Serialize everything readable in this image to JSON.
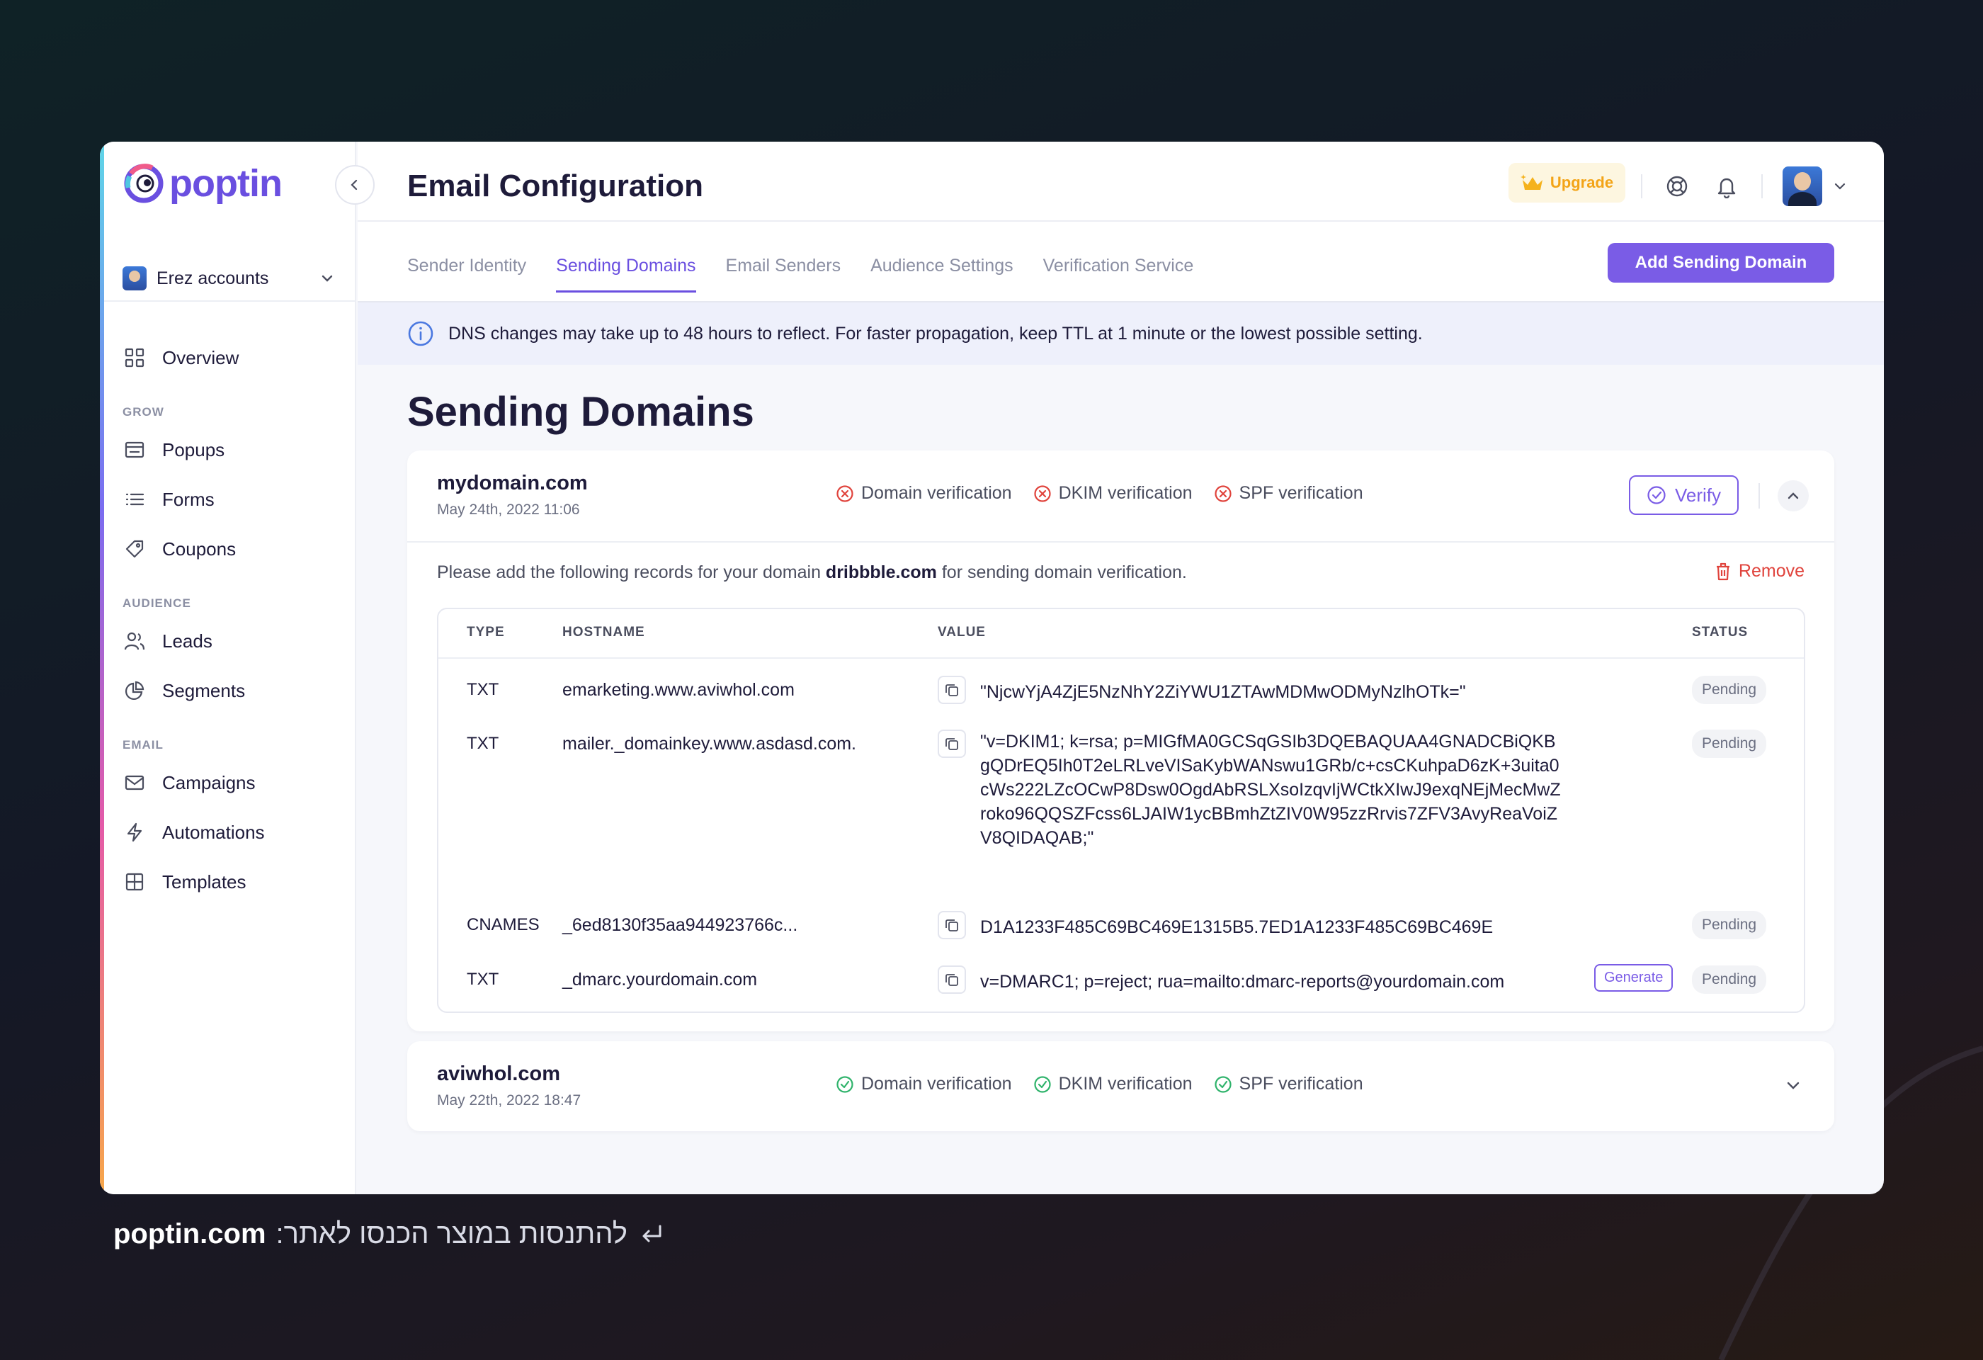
{
  "app": {
    "logo_text": "poptin",
    "page_title": "Email Configuration",
    "upgrade_label": "Upgrade"
  },
  "sidebar": {
    "account_label": "Erez accounts",
    "overview": "Overview",
    "sections": {
      "grow": "GROW",
      "audience": "AUDIENCE",
      "email": "EMAIL"
    },
    "grow_items": [
      "Popups",
      "Forms",
      "Coupons"
    ],
    "audience_items": [
      "Leads",
      "Segments"
    ],
    "email_items": [
      "Campaigns",
      "Automations",
      "Templates"
    ]
  },
  "tabs": [
    "Sender Identity",
    "Sending Domains",
    "Email Senders",
    "Audience Settings",
    "Verification Service"
  ],
  "active_tab": "Sending Domains",
  "add_button": "Add Sending Domain",
  "banner": "DNS changes may take up to 48 hours to reflect. For faster propagation, keep TTL at 1 minute or the lowest possible setting.",
  "section_title": "Sending Domains",
  "domains": [
    {
      "name": "mydomain.com",
      "date": "May 24th, 2022 11:06",
      "checks": [
        "Domain verification",
        "DKIM verification",
        "SPF verification"
      ],
      "check_state": "failed",
      "verify_label": "Verify",
      "instruction_prefix": "Please add the following records for your domain",
      "instruction_domain": "dribbble.com",
      "instruction_suffix": "for sending domain verification.",
      "remove_label": "Remove",
      "table": {
        "headers": [
          "TYPE",
          "HOSTNAME",
          "VALUE",
          "STATUS"
        ],
        "rows": [
          {
            "type": "TXT",
            "host": "emarketing.www.aviwhol.com",
            "value": "\"NjcwYjA4ZjE5NzNhY2ZiYWU1ZTAwMDMwODMyNzlhOTk=\"",
            "status": "Pending"
          },
          {
            "type": "TXT",
            "host": "mailer._domainkey.www.asdasd.com.",
            "value": "\"v=DKIM1; k=rsa; p=MIGfMA0GCSqGSIb3DQEBAQUAA4GNADCBiQKBgQDrEQ5Ih0T2eLRLveVISaKybWANswu1GRb/c+csCKuhpaD6zK+3uita0cWs222LZcOCwP8Dsw0OgdAbRSLXsoIzqvIjWCtkXIwJ9exqNEjMecMwZroko96QQSZFcss6LJAIW1ycBBmhZtZIV0W95zzRrvis7ZFV3AvyReaVoiZV8QIDAQAB;\"",
            "status": "Pending"
          },
          {
            "type": "CNAMES",
            "host": "_6ed8130f35aa944923766c...",
            "value": "D1A1233F485C69BC469E1315B5.7ED1A1233F485C69BC469E",
            "status": "Pending"
          },
          {
            "type": "TXT",
            "host": "_dmarc.yourdomain.com",
            "value": "v=DMARC1; p=reject; rua=mailto:dmarc-reports@yourdomain.com",
            "status": "Pending",
            "generate_label": "Generate"
          }
        ]
      }
    },
    {
      "name": "aviwhol.com",
      "date": "May 22th, 2022 18:47",
      "checks": [
        "Domain verification",
        "DKIM verification",
        "SPF verification"
      ],
      "check_state": "passed"
    }
  ],
  "footer": {
    "site": "poptin.com",
    "hebrew": "להתנסות במוצר הכנסו לאתר:"
  },
  "colors": {
    "brand": "#6a4fe0",
    "button": "#7a5ce6",
    "error": "#e0433c",
    "success": "#2fb36b",
    "upgrade": "#f3a417"
  }
}
